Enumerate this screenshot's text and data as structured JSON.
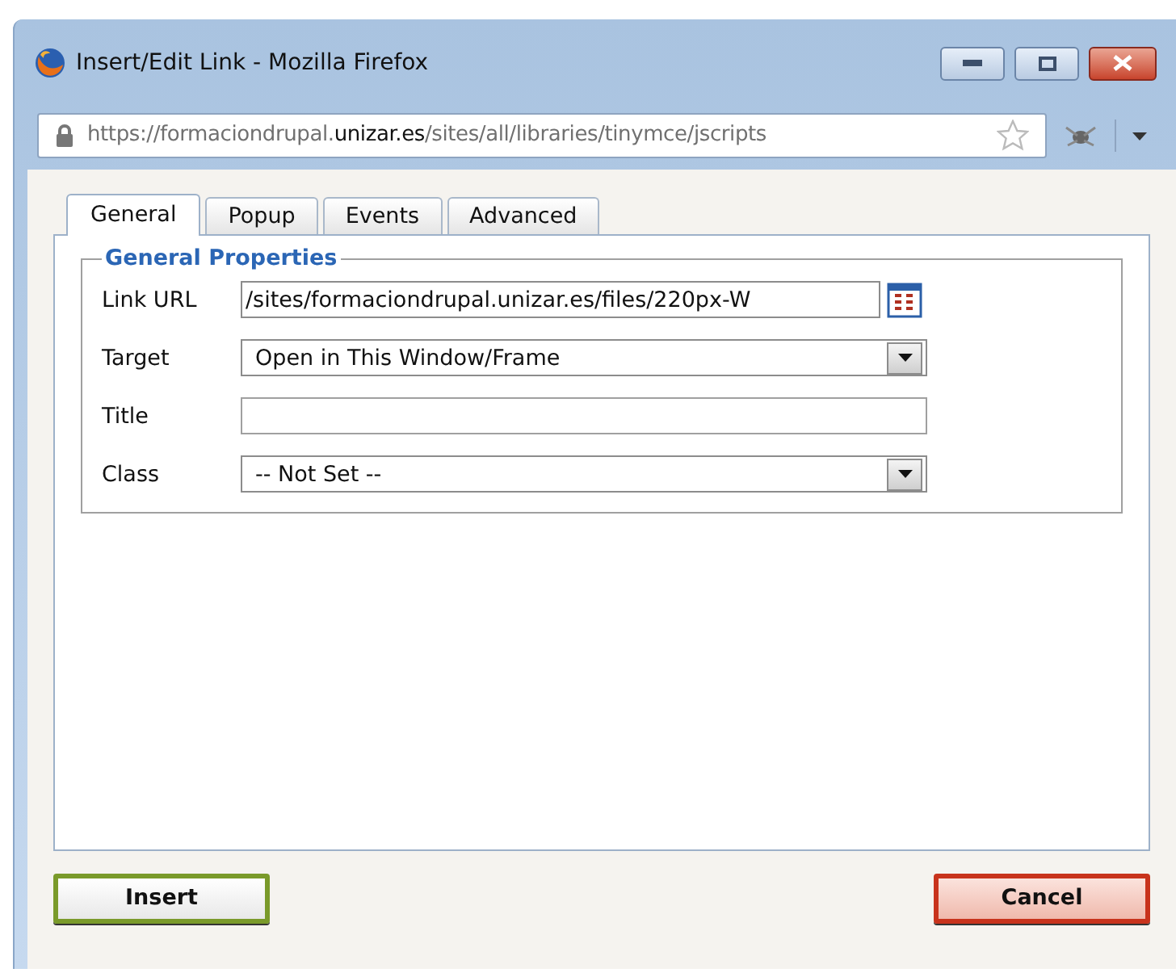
{
  "window": {
    "title": "Insert/Edit Link - Mozilla Firefox"
  },
  "address_bar": {
    "url_start": "https://formaciondrupal.",
    "url_domain": "unizar.es",
    "url_end": "/sites/all/libraries/tinymce/jscripts"
  },
  "tabs": [
    {
      "label": "General",
      "selected": true
    },
    {
      "label": "Popup",
      "selected": false
    },
    {
      "label": "Events",
      "selected": false
    },
    {
      "label": "Advanced",
      "selected": false
    }
  ],
  "fieldset": {
    "legend": "General Properties"
  },
  "fields": [
    {
      "label": "Link URL",
      "kind": "url",
      "value": "/sites/formaciondrupal.unizar.es/files/220px-W"
    },
    {
      "label": "Target",
      "kind": "select",
      "value": "Open in This Window/Frame"
    },
    {
      "label": "Title",
      "kind": "text"
    },
    {
      "label": "Class",
      "kind": "select",
      "value": "-- Not Set --"
    }
  ],
  "buttons": [
    {
      "label": "Insert",
      "kind": "primary"
    },
    {
      "label": "Cancel",
      "kind": "cancel"
    }
  ]
}
